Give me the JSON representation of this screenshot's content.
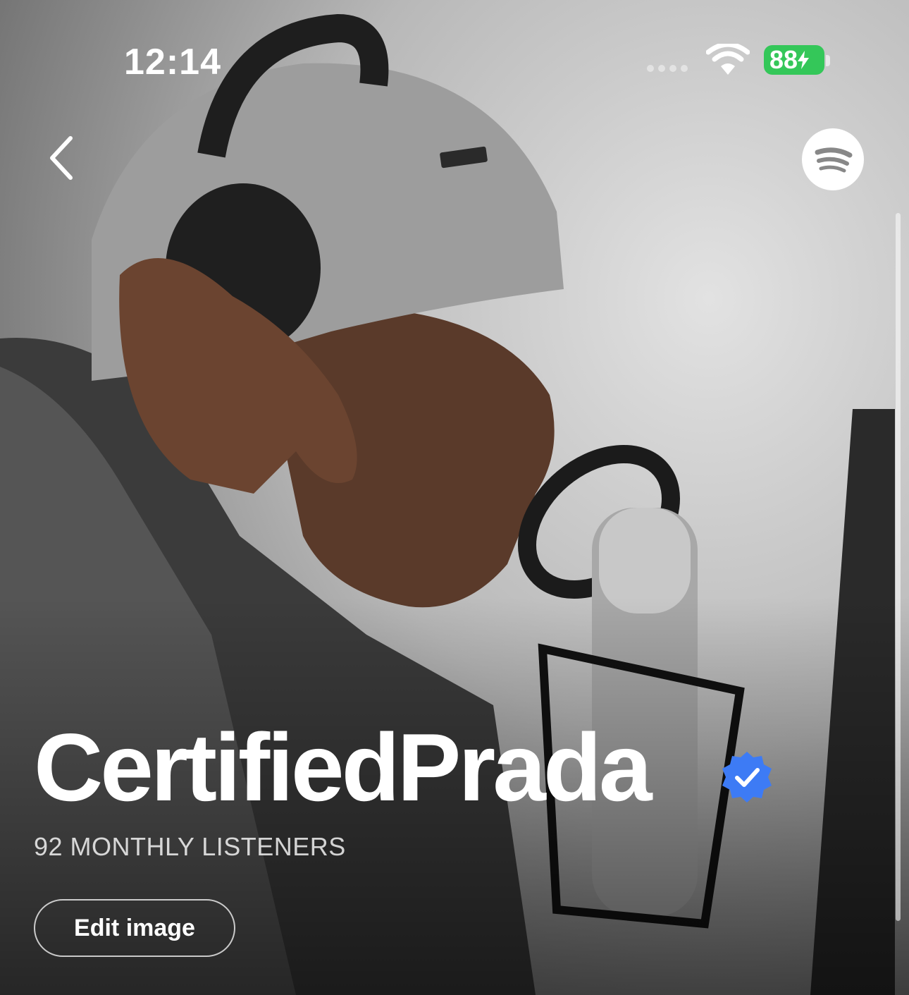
{
  "status_bar": {
    "time": "12:14",
    "battery": "88",
    "battery_color": "#34c759",
    "icons": [
      "cellular-signal-icon",
      "wifi-icon",
      "battery-charging-icon"
    ]
  },
  "nav": {
    "back_icon": "chevron-left-icon",
    "brand_icon": "spotify-logo-icon"
  },
  "artist": {
    "name": "CertifiedPrada",
    "verified_icon": "verified-badge-icon",
    "verified_color": "#3d7bf5",
    "monthly_listeners": "92 MONTHLY LISTENERS"
  },
  "actions": {
    "edit_image_label": "Edit image"
  }
}
